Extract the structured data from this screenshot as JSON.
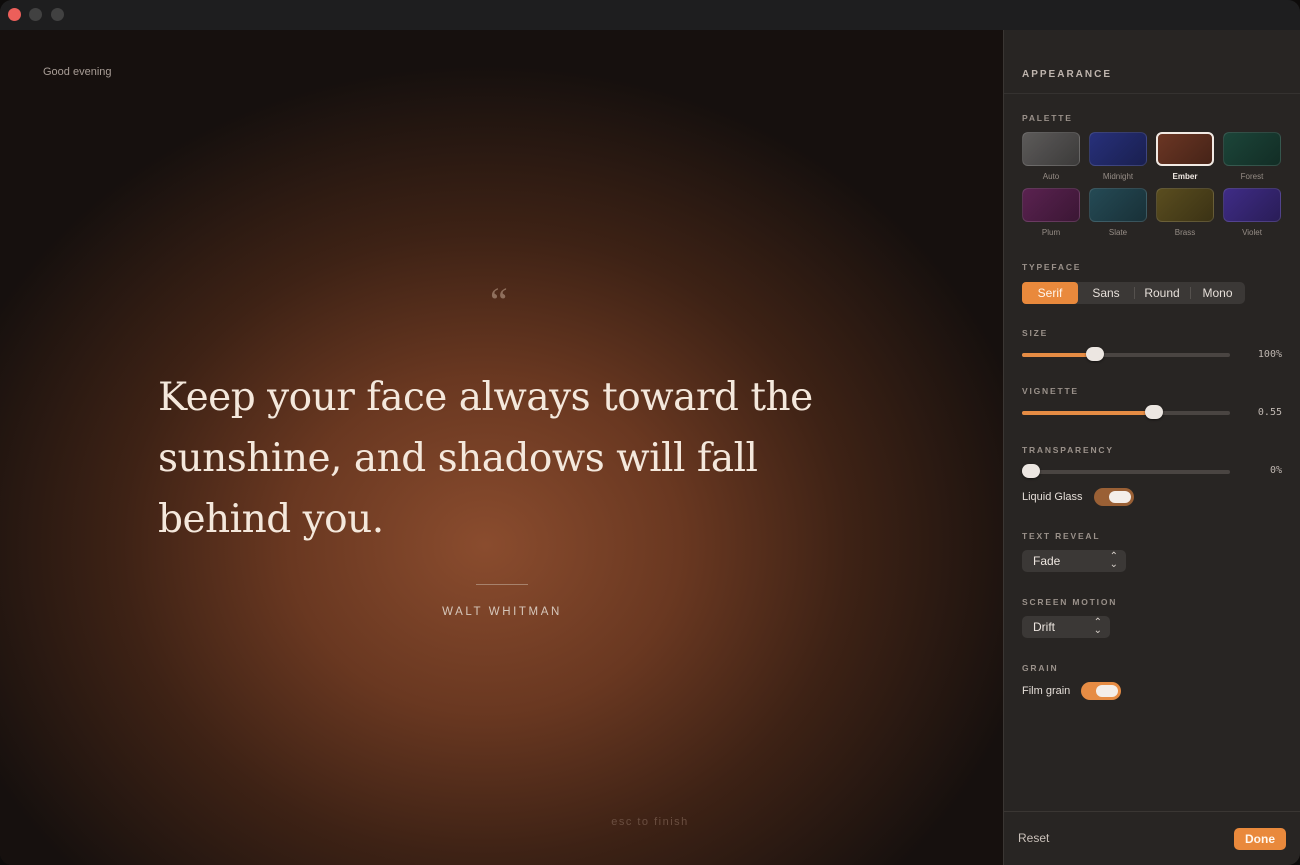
{
  "stage": {
    "greeting": "Good evening",
    "quote_mark": "“",
    "quote": "Keep your face always toward the sunshine, and shadows will fall behind you.",
    "author": "WALT WHITMAN",
    "hint": "esc to finish"
  },
  "panel": {
    "title": "APPEARANCE",
    "palette": {
      "label": "PALETTE",
      "selected": "Ember",
      "swatches": [
        {
          "name": "Auto",
          "color": "#5c5a59"
        },
        {
          "name": "Midnight",
          "color": "#27307a"
        },
        {
          "name": "Ember",
          "color": "#6b3624"
        },
        {
          "name": "Forest",
          "color": "#1c4539"
        },
        {
          "name": "Plum",
          "color": "#5a2250"
        },
        {
          "name": "Slate",
          "color": "#254a55"
        },
        {
          "name": "Brass",
          "color": "#5a4d1f"
        },
        {
          "name": "Violet",
          "color": "#3f2c86"
        }
      ]
    },
    "typeface": {
      "label": "TYPEFACE",
      "options": [
        "Serif",
        "Sans",
        "Round",
        "Mono"
      ],
      "selected": "Serif"
    },
    "size": {
      "label": "SIZE",
      "value_text": "100%",
      "fraction": 0.35
    },
    "vignette": {
      "label": "VIGNETTE",
      "value_text": "0.55",
      "fraction": 0.635
    },
    "transparency": {
      "label": "TRANSPARENCY",
      "value_text": "0%",
      "fraction": 0.0
    },
    "liquid_glass": {
      "label": "Liquid Glass",
      "on": true
    },
    "text_reveal": {
      "label": "TEXT REVEAL",
      "value": "Fade"
    },
    "screen_motion": {
      "label": "SCREEN MOTION",
      "value": "Drift"
    },
    "grain": {
      "label": "GRAIN",
      "toggle_label": "Film grain",
      "on": true
    },
    "reset_label": "Reset",
    "done_label": "Done"
  }
}
